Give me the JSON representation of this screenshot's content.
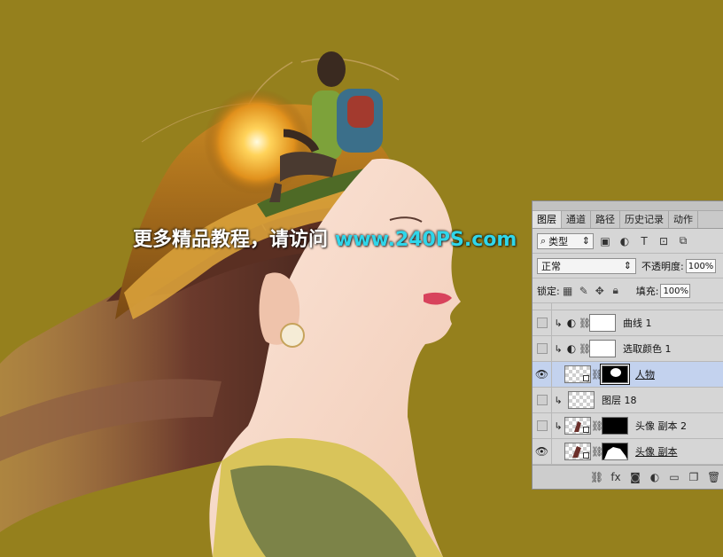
{
  "watermark": {
    "text_cn": "更多精品教程，请访问",
    "url": "www.240PS.com"
  },
  "colors": {
    "background": "#95801d",
    "watermark_url": "#2fd6ea",
    "selected_layer": "#c3d2ee"
  },
  "layers_panel": {
    "tabs": [
      {
        "label": "图层",
        "active": true
      },
      {
        "label": "通道",
        "active": false
      },
      {
        "label": "路径",
        "active": false
      },
      {
        "label": "历史记录",
        "active": false
      },
      {
        "label": "动作",
        "active": false
      }
    ],
    "filter": {
      "search_icon": "⌕",
      "label": "类型"
    },
    "blend_mode": "正常",
    "opacity_label": "不透明度:",
    "opacity_value": "100%",
    "lock_label": "锁定:",
    "fill_label": "填充:",
    "fill_value": "100%",
    "layers": [
      {
        "name": "曲线 1",
        "visible": false,
        "clipped": true,
        "type": "curves"
      },
      {
        "name": "选取颜色 1",
        "visible": false,
        "clipped": true,
        "type": "selective-color"
      },
      {
        "name": "人物",
        "visible": true,
        "clipped": false,
        "type": "smart-mask",
        "selected": true
      },
      {
        "name": "图层 18",
        "visible": false,
        "clipped": true,
        "type": "pixel"
      },
      {
        "name": "头像 副本 2",
        "visible": false,
        "clipped": true,
        "type": "smart-mask"
      },
      {
        "name": "头像 副本",
        "visible": true,
        "clipped": false,
        "type": "smart-mask"
      }
    ]
  }
}
